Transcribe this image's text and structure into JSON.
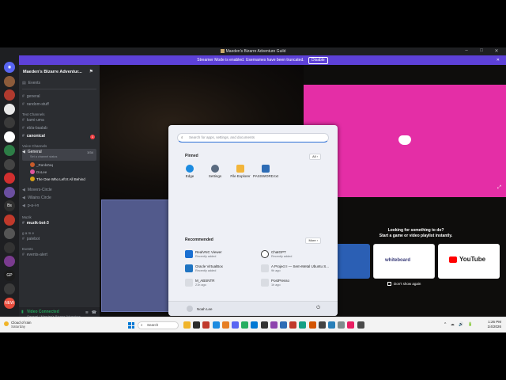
{
  "window": {
    "title": "Maeden's Bizarre Adventure Guild",
    "minimize": "–",
    "maximize": "□",
    "close": "✕"
  },
  "banner": {
    "text": "Streamer Mode is enabled. Usernames have been truncated.",
    "button": "Disable",
    "close": "✕"
  },
  "servers": [
    {
      "name": "DM",
      "color": "#5865f2",
      "label": "◉"
    },
    {
      "name": "server-1",
      "color": "#8c5b3a",
      "label": ""
    },
    {
      "name": "server-2",
      "color": "#b03a2e",
      "label": ""
    },
    {
      "name": "server-3",
      "color": "#e8e8e8",
      "label": ""
    },
    {
      "name": "server-4",
      "color": "#3a3a3a",
      "label": ""
    },
    {
      "name": "server-5",
      "color": "#ffffff",
      "label": ""
    },
    {
      "name": "server-6",
      "color": "#2d7d46",
      "label": ""
    },
    {
      "name": "server-7",
      "color": "#444444",
      "label": ""
    },
    {
      "name": "server-8",
      "color": "#d12f2f",
      "label": ""
    },
    {
      "name": "server-9",
      "color": "#6b4fa0",
      "label": ""
    },
    {
      "name": "server-10",
      "color": "#2f2f2f",
      "label": "Bs"
    },
    {
      "name": "server-11",
      "color": "#c0392b",
      "label": ""
    },
    {
      "name": "server-12",
      "color": "#555555",
      "label": ""
    },
    {
      "name": "server-13",
      "color": "#333333",
      "label": ""
    },
    {
      "name": "server-14",
      "color": "#7a3b8f",
      "label": ""
    },
    {
      "name": "server-15",
      "color": "#1c1c1c",
      "label": "GP"
    },
    {
      "name": "server-16",
      "color": "#3b3b3b",
      "label": ""
    },
    {
      "name": "server-17",
      "color": "#e74c3c",
      "label": "NEW"
    }
  ],
  "sidebar": {
    "guild_name": "Maeden's Bizarre Adventur...",
    "events": "Events",
    "channels_top": [
      "general",
      "random-stuff"
    ],
    "text_category": "Text Channels",
    "text_channels": [
      "kami-uma",
      "ebla-baalab",
      "canonical"
    ],
    "canonical_badge": "1",
    "voice_category": "Voice Channels",
    "voice_general": "General",
    "voice_general_count": "3/34",
    "voice_general_status": "Set a channel status",
    "voice_users": [
      "_RanbZaq",
      "DoLee",
      "The One Who Left It All Behind"
    ],
    "voice_channels": [
      "Movers-Circle",
      "Villains Circle",
      "p-a-i-n"
    ],
    "muzik_category": "Muzik",
    "muzik_channel": "muzik-bot-3",
    "game_category": "g a m e",
    "game_channel": "palebot",
    "events_category": "Events",
    "events_channel": "events-alert"
  },
  "voice_panel": {
    "title": "Video Connected",
    "subtitle": "General / Maeden's Bizarre Adventure...",
    "buttons": [
      "🎥",
      "🖥",
      "▦",
      "🔊"
    ]
  },
  "promo": {
    "title": "Looking for something to do?",
    "subtitle": "Start a game or video playlist instantly.",
    "dont_show": "Don't show again",
    "cards": [
      {
        "name": "tv-card",
        "color": "#2b5fb4",
        "label": ""
      },
      {
        "name": "whiteboard-card",
        "color": "#ffffff",
        "label": "whiteboard"
      },
      {
        "name": "youtube-card",
        "color": "#ffffff",
        "label": "YouTube"
      }
    ]
  },
  "start_menu": {
    "search_placeholder": "Search for apps, settings, and documents",
    "pinned_label": "Pinned",
    "all_button": "All ›",
    "pinned": [
      {
        "name": "Edge",
        "color": "#1c8be0"
      },
      {
        "name": "Settings",
        "color": "#5a6b80"
      },
      {
        "name": "File Explorer",
        "color": "#f2b53a"
      },
      {
        "name": "PASSWORD.txt",
        "color": "#2d6cb5"
      }
    ],
    "recommended_label": "Recommended",
    "more_button": "More ›",
    "recommended": [
      {
        "name": "RealVNC Viewer",
        "sub": "Recently added",
        "color": "#1a6fd1"
      },
      {
        "name": "ChatGPT",
        "sub": "Recently added",
        "color": "#ffffff"
      },
      {
        "name": "Oracle VirtualBox",
        "sub": "Recently added",
        "color": "#1f74c2"
      },
      {
        "name": "A Project I — Sem-Metal Ubuntu S...",
        "sub": "9h ago",
        "color": "#d9dce2"
      },
      {
        "name": "M_ABSNTR",
        "sub": "21h ago",
        "color": "#d9dce2"
      },
      {
        "name": "PostPresso",
        "sub": "1h ago",
        "color": "#d9dce2"
      }
    ],
    "user": "Noah Lee",
    "power": "⏻"
  },
  "taskbar": {
    "weather_temp": "Cloud of rain",
    "weather_sub": "Saturday",
    "search": "Search",
    "apps": [
      "#f0b429",
      "#2b2b2b",
      "#c0392b",
      "#1c8be0",
      "#e67e22",
      "#5865f2",
      "#27ae60",
      "#0078d4",
      "#333333",
      "#8e44ad",
      "#2d6cb5",
      "#c0392b",
      "#16a085",
      "#d35400",
      "#444444",
      "#2980b9",
      "#7f8c8d",
      "#e91e63",
      "#4a4a4a"
    ],
    "tray_icons": "^ ☁ 🔊 🔋",
    "time": "1:26 PM",
    "date": "1/4/2026"
  }
}
